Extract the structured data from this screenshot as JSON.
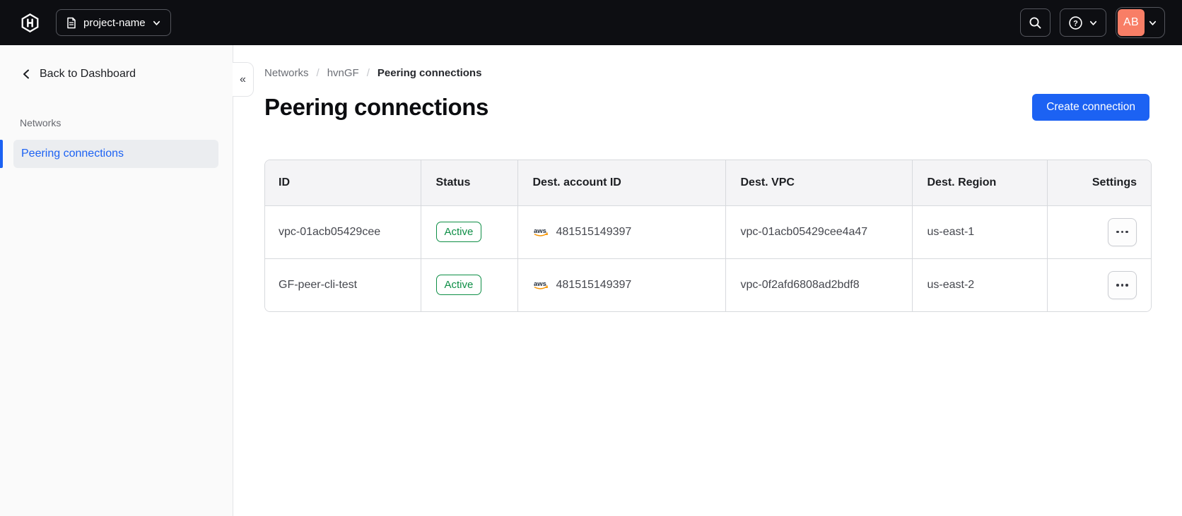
{
  "colors": {
    "topbar_bg": "#0d0e12",
    "accent_blue": "#1c62f3",
    "avatar_bg": "#f87e66",
    "status_green": "#0e8e46",
    "sidebar_bg": "#fafafa",
    "header_row_bg": "#f4f4f6"
  },
  "topbar": {
    "logo": "hashicorp-logo",
    "project_switcher": {
      "label": "project-name"
    },
    "avatar": {
      "initials": "AB"
    }
  },
  "sidebar": {
    "back_label": "Back to Dashboard",
    "section_label": "Networks",
    "items": [
      {
        "label": "Peering connections",
        "active": true
      }
    ],
    "collapse_glyph": "«"
  },
  "breadcrumb": {
    "items": [
      "Networks",
      "hvnGF",
      "Peering connections"
    ],
    "separator": "/"
  },
  "page": {
    "title": "Peering connections",
    "create_button_label": "Create connection"
  },
  "table": {
    "headers": [
      "ID",
      "Status",
      "Dest. account ID",
      "Dest. VPC",
      "Dest. Region",
      "Settings"
    ],
    "provider_icon": "aws-icon",
    "rows": [
      {
        "id": "vpc-01acb05429cee",
        "status": "Active",
        "account_id": "481515149397",
        "vpc": "vpc-01acb05429cee4a47",
        "region": "us-east-1"
      },
      {
        "id": "GF-peer-cli-test",
        "status": "Active",
        "account_id": "481515149397",
        "vpc": "vpc-0f2afd6808ad2bdf8",
        "region": "us-east-2"
      }
    ]
  }
}
